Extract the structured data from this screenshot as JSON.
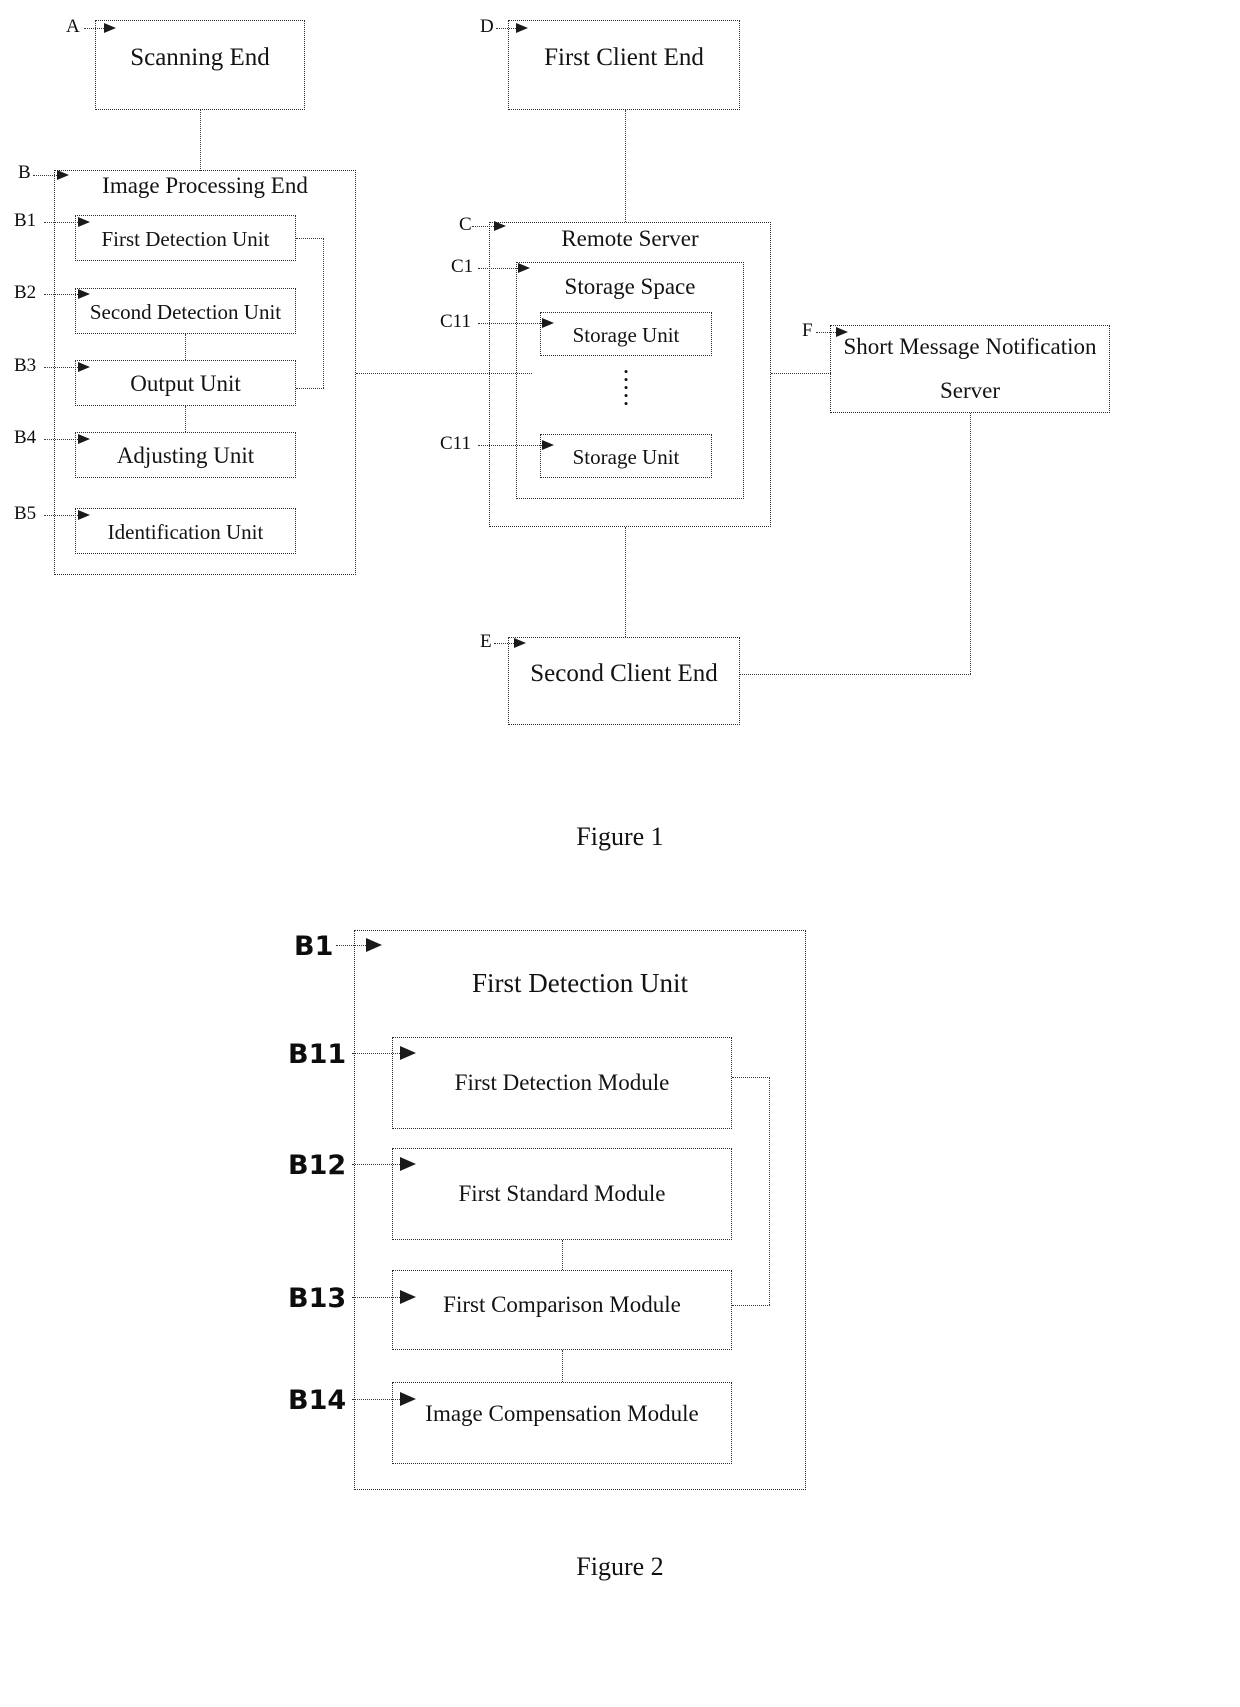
{
  "figure1": {
    "caption": "Figure 1",
    "blocks": {
      "scanning_end": {
        "label": "Scanning End",
        "ref": "A"
      },
      "image_processing_end": {
        "label": "Image Processing End",
        "ref": "B"
      },
      "first_detection_unit": {
        "label": "First Detection Unit",
        "ref": "B1"
      },
      "second_detection_unit": {
        "label": "Second Detection Unit",
        "ref": "B2"
      },
      "output_unit": {
        "label": "Output Unit",
        "ref": "B3"
      },
      "adjusting_unit": {
        "label": "Adjusting Unit",
        "ref": "B4"
      },
      "identification_unit": {
        "label": "Identification Unit",
        "ref": "B5"
      },
      "first_client_end": {
        "label": "First Client End",
        "ref": "D"
      },
      "remote_server": {
        "label": "Remote Server",
        "ref": "C"
      },
      "storage_space": {
        "label": "Storage Space",
        "ref": "C1"
      },
      "storage_unit_top": {
        "label": "Storage Unit",
        "ref": "C11"
      },
      "storage_unit_bottom": {
        "label": "Storage Unit",
        "ref": "C11"
      },
      "short_message_notification_server": {
        "label_line1": "Short Message Notification",
        "label_line2": "Server",
        "ref": "F"
      },
      "second_client_end": {
        "label": "Second Client End",
        "ref": "E"
      }
    }
  },
  "figure2": {
    "caption": "Figure 2",
    "blocks": {
      "first_detection_unit": {
        "label": "First Detection Unit",
        "ref": "B1"
      },
      "first_detection_module": {
        "label": "First Detection Module",
        "ref": "B11"
      },
      "first_standard_module": {
        "label": "First Standard Module",
        "ref": "B12"
      },
      "first_comparison_module": {
        "label": "First Comparison Module",
        "ref": "B13"
      },
      "image_compensation_module": {
        "label": "Image Compensation Module",
        "ref": "B14"
      }
    }
  }
}
